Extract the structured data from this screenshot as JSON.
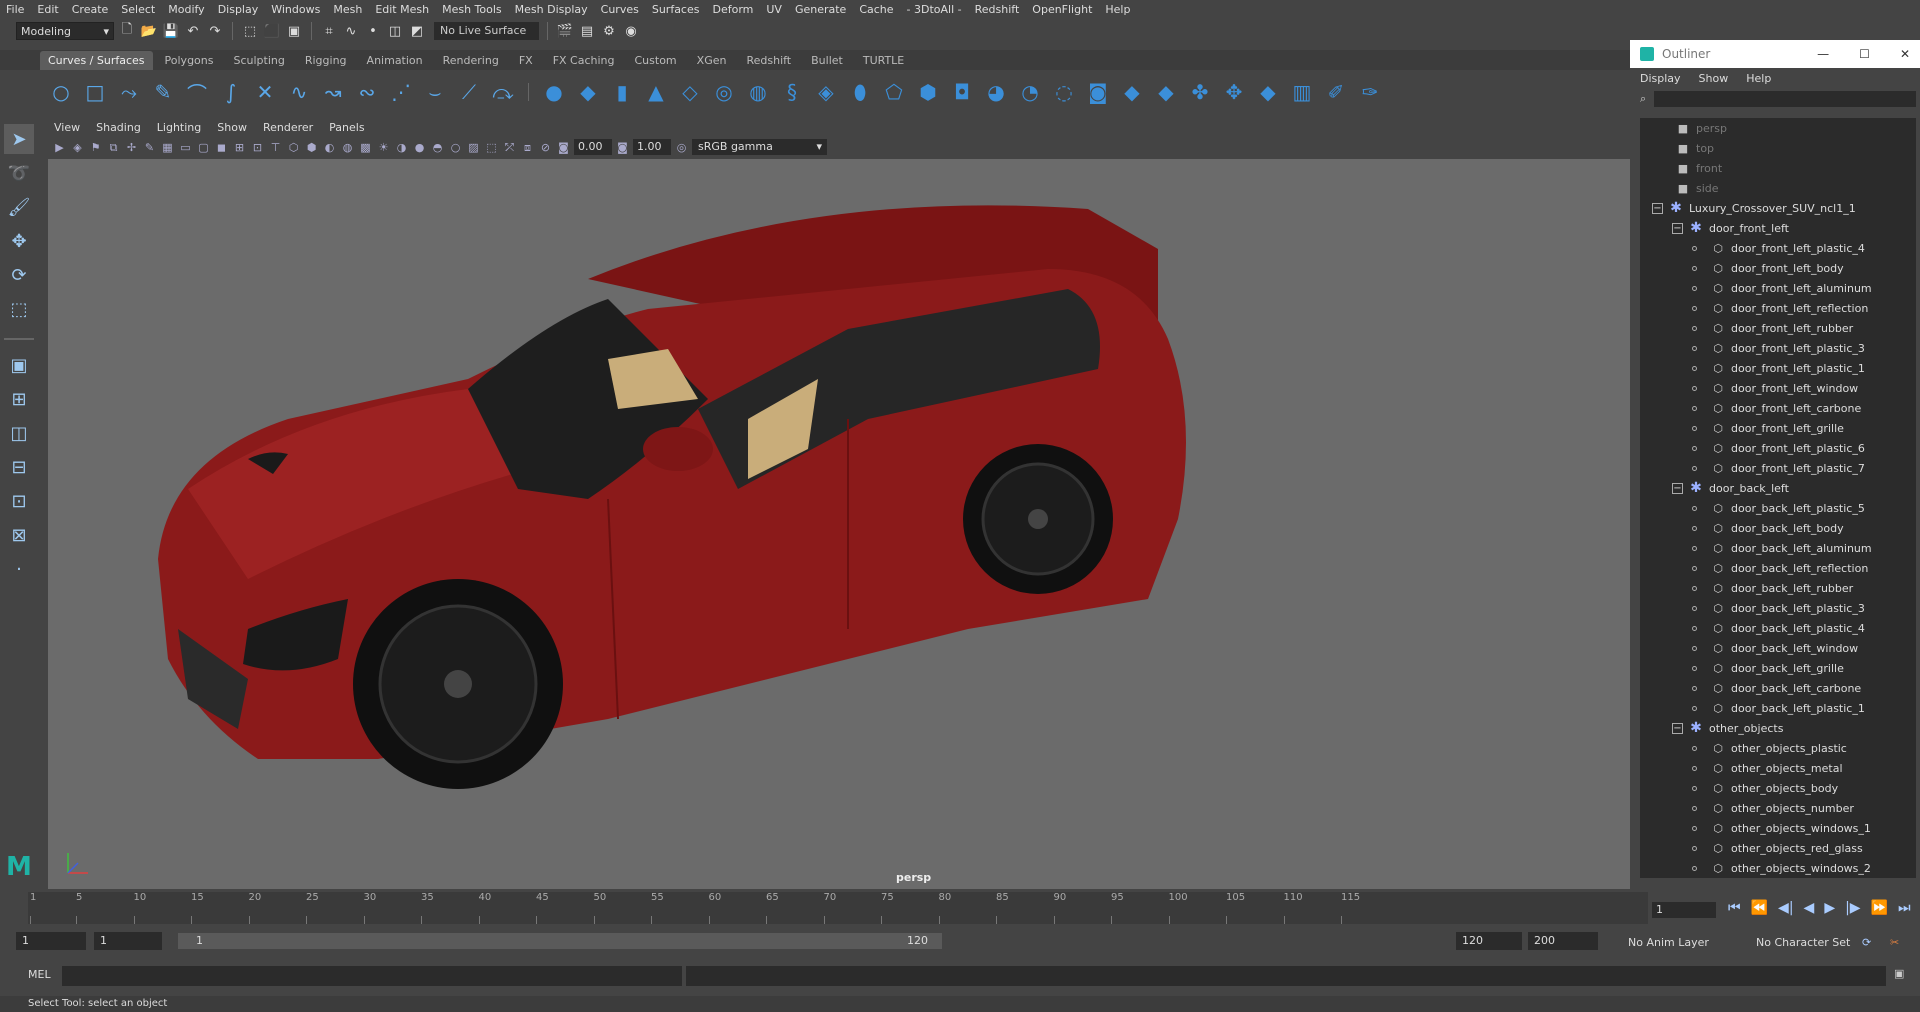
{
  "menu": [
    "File",
    "Edit",
    "Create",
    "Select",
    "Modify",
    "Display",
    "Windows",
    "Mesh",
    "Edit Mesh",
    "Mesh Tools",
    "Mesh Display",
    "Curves",
    "Surfaces",
    "Deform",
    "UV",
    "Generate",
    "Cache",
    "- 3DtoAll -",
    "Redshift",
    "OpenFlight",
    "Help"
  ],
  "statusline": {
    "mode": "Modeling",
    "live_surface": "No Live Surface"
  },
  "shelf_tabs": [
    "Curves / Surfaces",
    "Polygons",
    "Sculpting",
    "Rigging",
    "Animation",
    "Rendering",
    "FX",
    "FX Caching",
    "Custom",
    "XGen",
    "Redshift",
    "Bullet",
    "TURTLE"
  ],
  "shelf_active": "Curves / Surfaces",
  "panel_menu": [
    "View",
    "Shading",
    "Lighting",
    "Show",
    "Renderer",
    "Panels"
  ],
  "panel_toolbar": {
    "exposure": "0.00",
    "gamma": "1.00",
    "color_space": "sRGB gamma"
  },
  "viewport": {
    "camera_label": "persp"
  },
  "outliner": {
    "title": "Outliner",
    "menu": [
      "Display",
      "Show",
      "Help"
    ],
    "cameras": [
      "persp",
      "top",
      "front",
      "side"
    ],
    "root": "Luxury_Crossover_SUV_ncl1_1",
    "groups": [
      {
        "name": "door_front_left",
        "children": [
          "door_front_left_plastic_4",
          "door_front_left_body",
          "door_front_left_aluminum",
          "door_front_left_reflection",
          "door_front_left_rubber",
          "door_front_left_plastic_3",
          "door_front_left_plastic_1",
          "door_front_left_window",
          "door_front_left_carbone",
          "door_front_left_grille",
          "door_front_left_plastic_6",
          "door_front_left_plastic_7"
        ]
      },
      {
        "name": "door_back_left",
        "children": [
          "door_back_left_plastic_5",
          "door_back_left_body",
          "door_back_left_aluminum",
          "door_back_left_reflection",
          "door_back_left_rubber",
          "door_back_left_plastic_3",
          "door_back_left_plastic_4",
          "door_back_left_window",
          "door_back_left_grille",
          "door_back_left_carbone",
          "door_back_left_plastic_1"
        ]
      },
      {
        "name": "other_objects",
        "children": [
          "other_objects_plastic",
          "other_objects_metal",
          "other_objects_body",
          "other_objects_number",
          "other_objects_windows_1",
          "other_objects_red_glass",
          "other_objects_windows_2"
        ]
      }
    ]
  },
  "timeline": {
    "ticks": [
      "1",
      "5",
      "10",
      "15",
      "20",
      "25",
      "30",
      "35",
      "40",
      "45",
      "50",
      "55",
      "60",
      "65",
      "70",
      "75",
      "80",
      "85",
      "90",
      "95",
      "100",
      "105",
      "110",
      "115"
    ],
    "current_frame": "1"
  },
  "range": {
    "start": "1",
    "playback_start": "1",
    "bar_start": "1",
    "bar_end": "120",
    "playback_end": "120",
    "end": "200",
    "anim_layer": "No Anim Layer",
    "character_set": "No Character Set"
  },
  "cmdline": {
    "label": "MEL"
  },
  "helpline": "Select Tool: select an object",
  "colors": {
    "car_body": "#8b1a1a",
    "viewport_bg": "#6b6b6b",
    "accent": "#1fb3a6"
  }
}
